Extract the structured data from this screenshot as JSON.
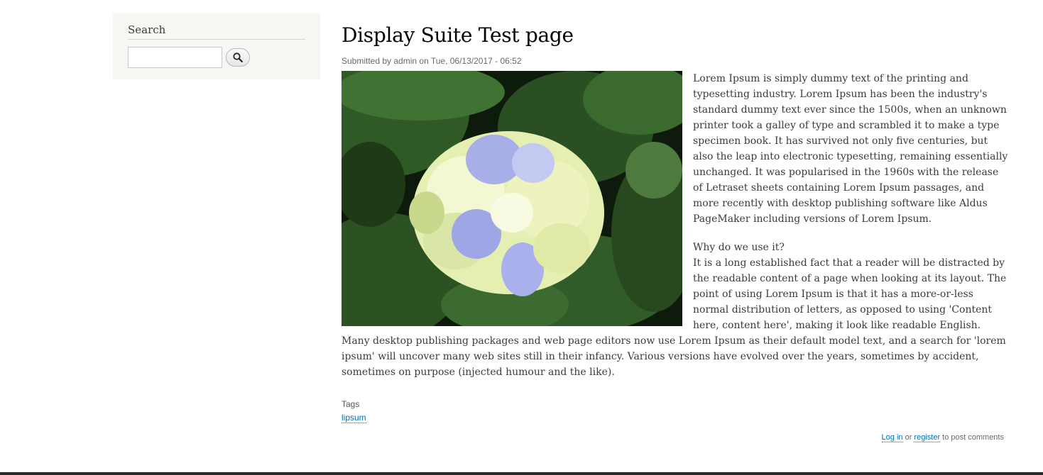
{
  "sidebar": {
    "search_title": "Search",
    "search_input_value": "",
    "search_button_icon": "magnifier-icon"
  },
  "article": {
    "title": "Display Suite Test page",
    "submitted": "Submitted by admin on Tue, 06/13/2017 - 06:52",
    "paragraph1": "Lorem Ipsum is simply dummy text of the printing and typesetting industry. Lorem Ipsum has been the industry's standard dummy text ever since the 1500s, when an unknown printer took a galley of type and scrambled it to make a type specimen book. It has survived not only five centuries, but also the leap into electronic typesetting, remaining essentially unchanged. It was popularised in the 1960s with the release of Letraset sheets containing Lorem Ipsum passages, and more recently with desktop publishing software like Aldus PageMaker including versions of Lorem Ipsum.",
    "heading2": "Why do we use it?",
    "paragraph2": "It is a long established fact that a reader will be distracted by the readable content of a page when looking at its layout. The point of using Lorem Ipsum is that it has a more-or-less normal distribution of letters, as opposed to using 'Content here, content here', making it look like readable English. Many desktop publishing packages and web page editors now use Lorem Ipsum as their default model text, and a search for 'lorem ipsum' will uncover many web sites still in their infancy. Various versions have evolved over the years, sometimes by accident, sometimes on purpose (injected humour and the like).",
    "tags_label": "Tags",
    "tag": "lipsum"
  },
  "comments": {
    "login": "Log in",
    "or": "or",
    "register": "register",
    "suffix": "to post comments"
  }
}
